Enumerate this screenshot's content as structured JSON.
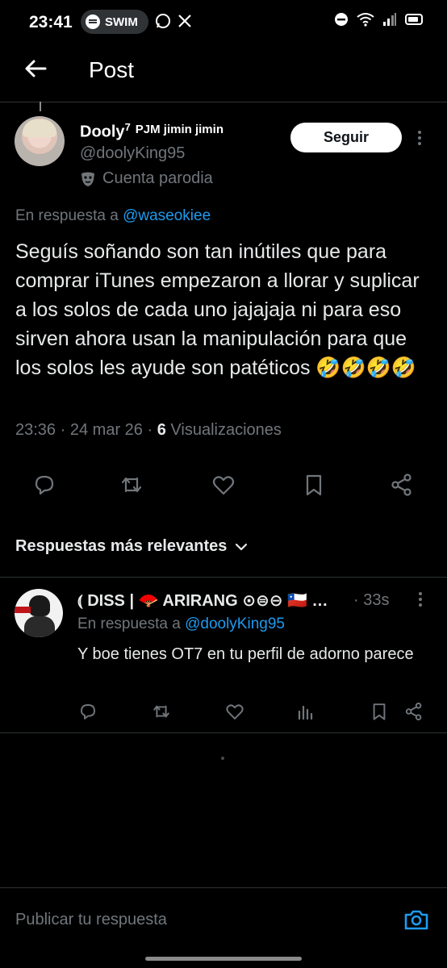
{
  "status_bar": {
    "time": "23:41",
    "music_label": "SWIM",
    "icons": [
      "spotify-icon",
      "whatsapp-icon",
      "x-icon",
      "dnd-icon",
      "wifi-icon",
      "signal-icon",
      "battery-icon"
    ]
  },
  "header": {
    "title": "Post",
    "back_icon": "arrow-left-icon"
  },
  "post": {
    "author_name": "Dooly",
    "author_superscript": "7",
    "author_suffix": "PJM jimin jimin",
    "handle": "@doolyKing95",
    "parody_label": "Cuenta parodia",
    "follow_label": "Seguir",
    "reply_prefix": "En respuesta a",
    "reply_handle": "@waseokiee",
    "text": "Seguís soñando son tan inútiles que para comprar iTunes empezaron a llorar y suplicar a los solos de cada uno jajajaja ni para eso sirven ahora usan la manipulación para que los solos les ayude son patéticos 🤣🤣🤣🤣",
    "time": "23:36",
    "date": "24 mar 26",
    "views_count": "6",
    "views_label": "Visualizaciones",
    "separator": "·"
  },
  "sort": {
    "label": "Respuestas más relevantes"
  },
  "replies": [
    {
      "name": "⦅ DISS | 🪭 ARIRANG ⊙⊜⊖ 🇨🇱 …",
      "time": "· 33s",
      "reply_prefix": "En respuesta a",
      "reply_handle": "@doolyKing95",
      "text": "Y boe tienes OT7 en tu perfil de adorno parece"
    }
  ],
  "compose": {
    "placeholder": "Publicar tu respuesta"
  },
  "colors": {
    "background": "#000000",
    "text": "#e7e9ea",
    "secondary": "#71767b",
    "accent": "#1d9bf0",
    "divider": "#2f3336"
  }
}
